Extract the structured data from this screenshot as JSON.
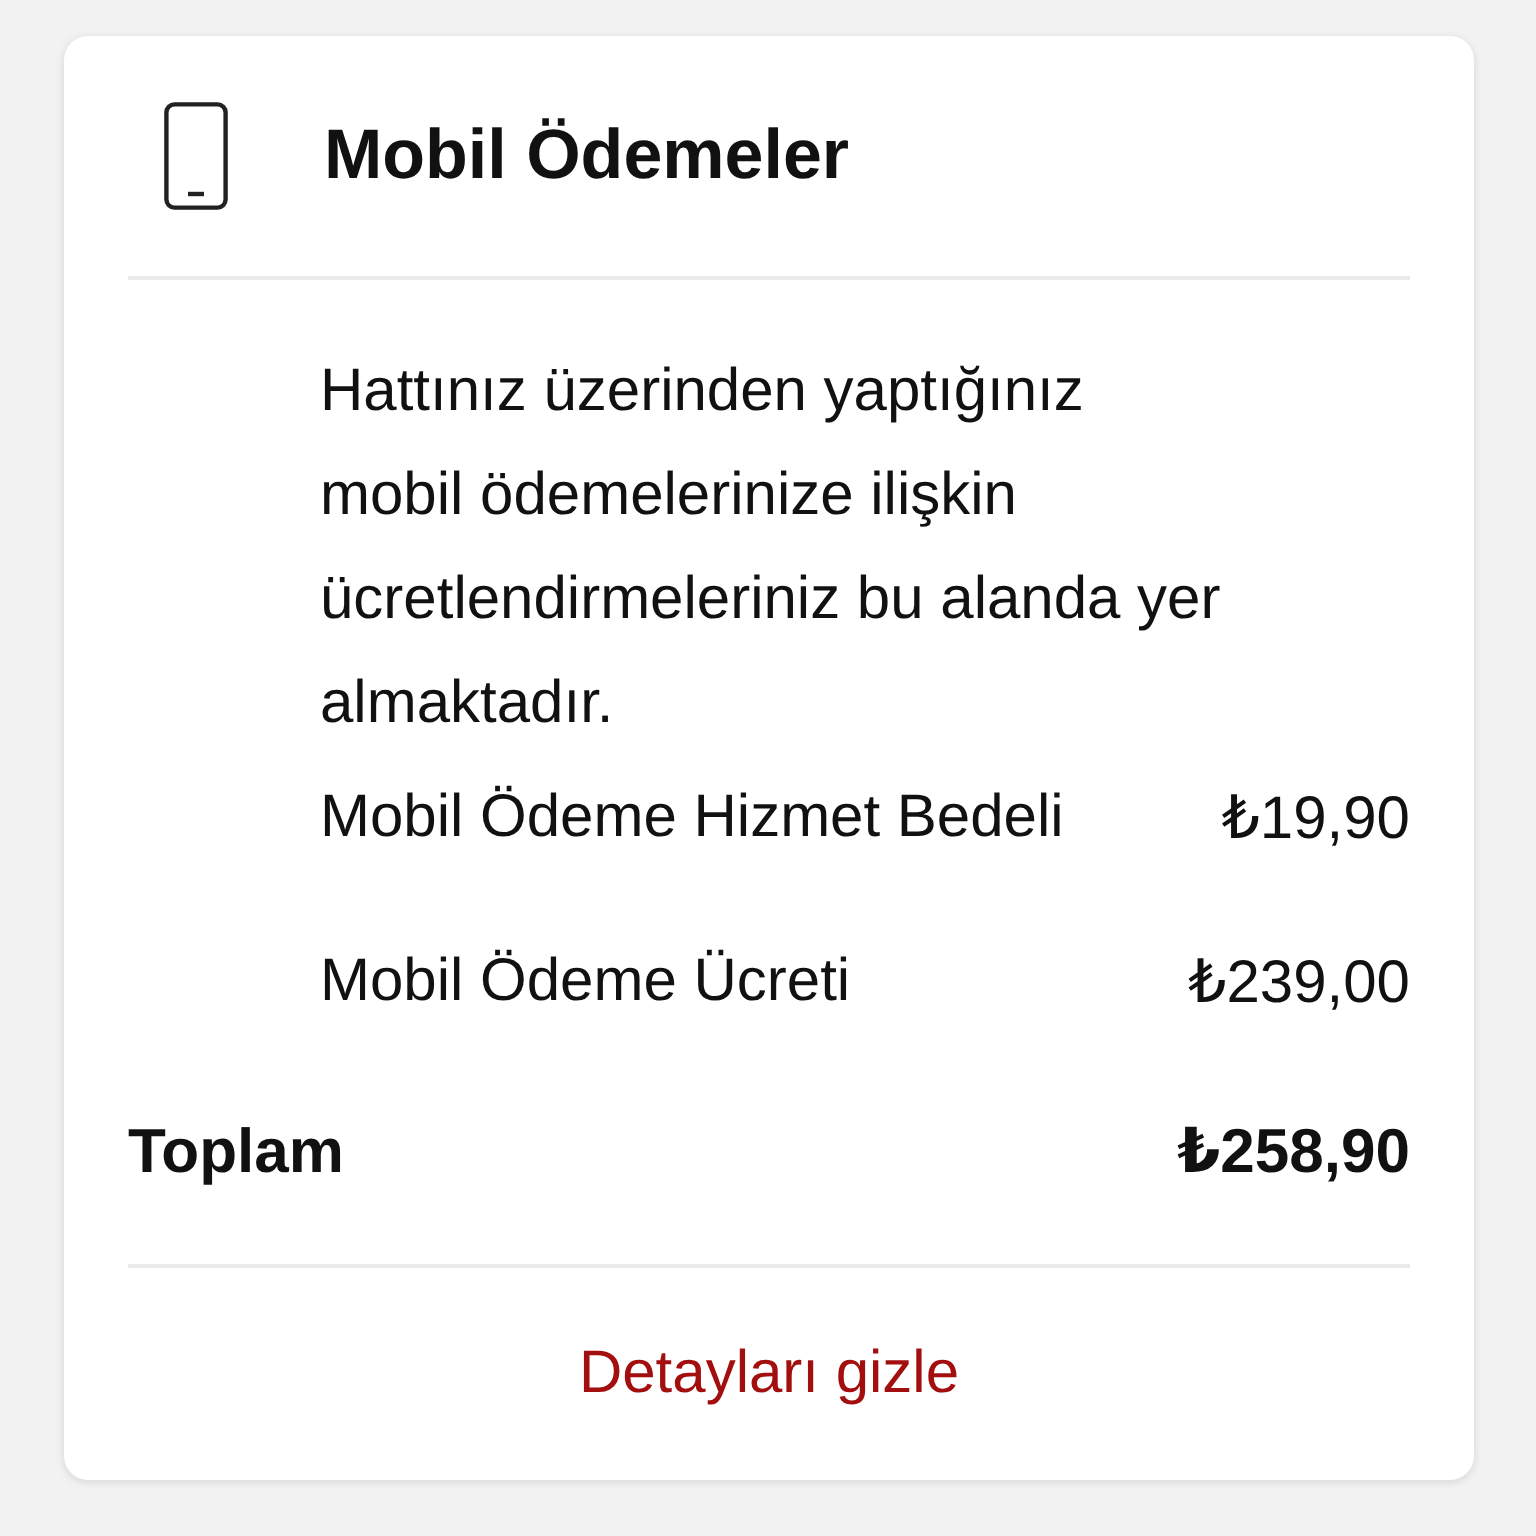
{
  "card": {
    "title": "Mobil Ödemeler",
    "description": "Hattınız üzerinden yaptığınız mobil ödemelerinize ilişkin ücretlendirmeleriniz bu alanda yer almaktadır.",
    "items": [
      {
        "label": "Mobil Ödeme Hizmet Bedeli",
        "amount": "₺19,90"
      },
      {
        "label": "Mobil Ödeme Ücreti",
        "amount": "₺239,00"
      }
    ],
    "total": {
      "label": "Toplam",
      "amount": "₺258,90"
    },
    "toggle_link": "Detayları gizle"
  }
}
